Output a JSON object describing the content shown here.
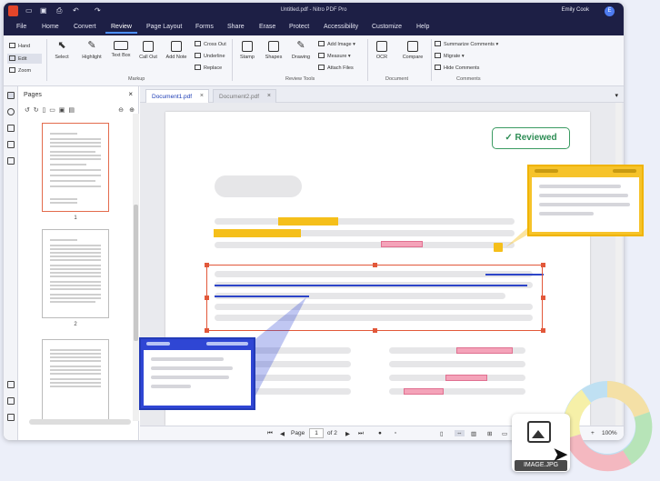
{
  "titlebar": {
    "title": "Untitled.pdf - Nitro PDF Pro",
    "user": "Emily Cook",
    "avatar": "E"
  },
  "menu": [
    "File",
    "Home",
    "Convert",
    "Review",
    "Page Layout",
    "Forms",
    "Share",
    "Erase",
    "Protect",
    "Accessibility",
    "Customize",
    "Help"
  ],
  "ribbon": {
    "hand": "Hand",
    "edit": "Edit",
    "zoom": "Zoom",
    "select": "Select",
    "highlight": "Highlight",
    "textbox": "Text Box",
    "callout": "Call Out",
    "addnote": "Add Note",
    "crossout": "Cross Out",
    "underline": "Underline",
    "replace": "Replace",
    "stamp": "Stamp",
    "shapes": "Shapes",
    "drawing": "Drawing",
    "addimage": "Add Image",
    "measure": "Measure",
    "attach": "Attach Files",
    "ocr": "OCR",
    "compare": "Compare",
    "summarize": "Summarize Comments",
    "migrate": "Migrate",
    "hide": "Hide Comments",
    "grp_markup": "Markup",
    "grp_review": "Review Tools",
    "grp_document": "Document",
    "grp_comments": "Comments"
  },
  "pages": {
    "title": "Pages",
    "thumbs": [
      "1",
      "2"
    ]
  },
  "tabs": [
    "Document1.pdf",
    "Document2.pdf"
  ],
  "badge": "Reviewed",
  "status": {
    "page_label": "Page",
    "page": "1",
    "of": "of 2",
    "zoom": "100%"
  },
  "image_label": "IMAGE.JPG",
  "colors": {
    "titlebar": "#1d1f45",
    "accent": "#4d90ff",
    "reviewed": "#2e8d55",
    "highlight": "#f5bf1a"
  }
}
